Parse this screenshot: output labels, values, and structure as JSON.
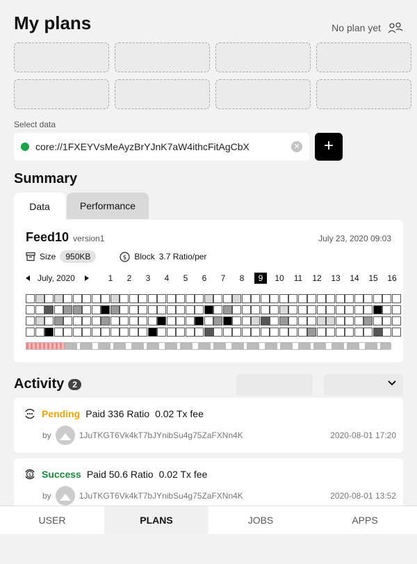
{
  "header": {
    "title": "My plans",
    "no_plan_text": "No plan yet",
    "no_plan_icon": "users-icon"
  },
  "select": {
    "label": "Select data",
    "value": "core://1FXEYVsMeAyzBrYJnK7aW4ithcFitAgCbX",
    "status_color": "#1aa34a",
    "clear_icon": "clear-icon",
    "add_label": "+"
  },
  "summary": {
    "title": "Summary",
    "tabs": [
      {
        "label": "Data",
        "active": true
      },
      {
        "label": "Performance",
        "active": false
      }
    ],
    "feed": {
      "name": "Feed10",
      "version": "version1",
      "date": "July 23, 2020 09:03"
    },
    "size_label": "Size",
    "size_value": "950KB",
    "block_label": "Block",
    "block_value": "3.7 Ratio/per",
    "month": "July, 2020",
    "days": [
      "1",
      "2",
      "3",
      "4",
      "5",
      "6",
      "7",
      "8",
      "9",
      "10",
      "11",
      "12",
      "13",
      "14",
      "15",
      "16"
    ],
    "selected_day": "9",
    "grid_rows": [
      "0101000001000000000100100000000000000000",
      "0030220042000000000402000001000000000400",
      "0102000020000040004024001302000110002000",
      "0040000000000400000300000000002000000300"
    ],
    "grid_levels": [
      "#ffffff",
      "#d9d9d9",
      "#999999",
      "#555555",
      "#000000"
    ]
  },
  "activity": {
    "title": "Activity",
    "count": "2",
    "items": [
      {
        "status": "Pending",
        "status_color": "#f0a500",
        "icon": "pending-icon",
        "amount": "Paid 336 Ratio",
        "fee": "0.02 Tx fee",
        "by": "by",
        "address": "1JuTKGT6Vk4kT7bJYnibSu4g75ZaFXNn4K",
        "time": "2020-08-01 17:20"
      },
      {
        "status": "Success",
        "status_color": "#1a8a3a",
        "icon": "dollar-icon",
        "amount": "Paid 50.6 Ratio",
        "fee": "0.02 Tx fee",
        "by": "by",
        "address": "1JuTKGT6Vk4kT7bJYnibSu4g75ZaFXNn4K",
        "time": "2020-08-01 13:52"
      }
    ]
  },
  "nav": {
    "items": [
      {
        "label": "USER"
      },
      {
        "label": "PLANS",
        "active": true
      },
      {
        "label": "JOBS"
      },
      {
        "label": "APPS"
      }
    ]
  }
}
